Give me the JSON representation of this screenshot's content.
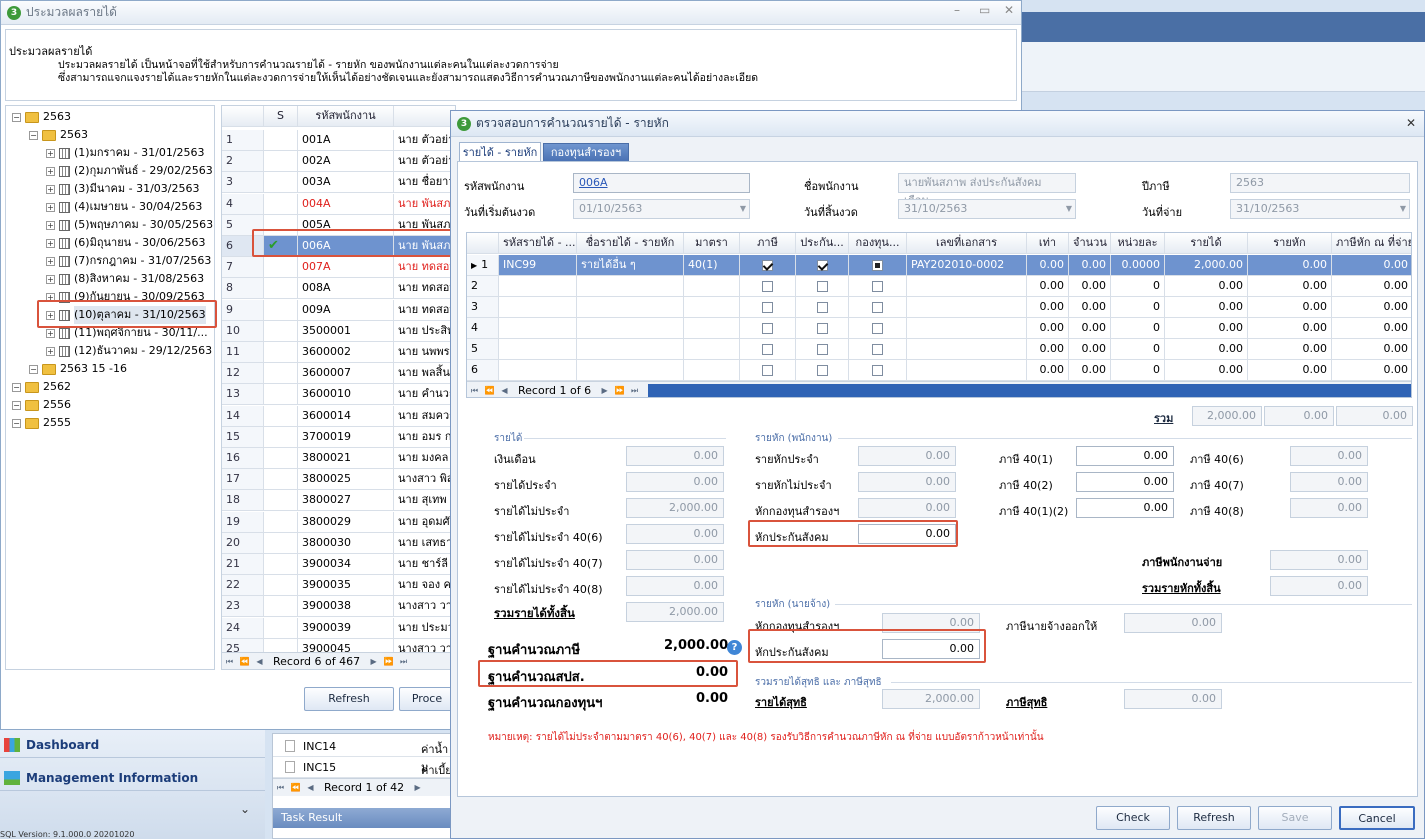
{
  "bg_window": {
    "title": "ประมวลผลรายได้",
    "desc_title": "ประมวลผลรายได้",
    "desc_line1": "ประมวลผลรายได้ เป็นหน้าจอที่ใช้สำหรับการคำนวณรายได้ - รายหัก ของพนักงานแต่ละคนในแต่ละงวดการจ่าย",
    "desc_line2": "ซึ่งสามารถแจกแจงรายได้และรายหักในแต่ละงวดการจ่ายให้เห็นได้อย่างชัดเจนและยังสามารถแสดงวิธีการคำนวณภาษีของพนักงานแต่ละคนได้อย่างละเอียด",
    "tree": [
      {
        "label": "2563",
        "level": 0
      },
      {
        "label": "2563",
        "level": 1
      },
      {
        "label": "(1)มกราคม - 31/01/2563",
        "level": 2
      },
      {
        "label": "(2)กุมภาพันธ์ - 29/02/2563",
        "level": 2
      },
      {
        "label": "(3)มีนาคม - 31/03/2563",
        "level": 2
      },
      {
        "label": "(4)เมษายน - 30/04/2563",
        "level": 2
      },
      {
        "label": "(5)พฤษภาคม - 30/05/2563",
        "level": 2
      },
      {
        "label": "(6)มิถุนายน - 30/06/2563",
        "level": 2
      },
      {
        "label": "(7)กรกฎาคม - 31/07/2563",
        "level": 2
      },
      {
        "label": "(8)สิงหาคม - 31/08/2563",
        "level": 2
      },
      {
        "label": "(9)กันยายน - 30/09/2563",
        "level": 2
      },
      {
        "label": "(10)ตุลาคม - 31/10/2563",
        "level": 2
      },
      {
        "label": "(11)พฤศจิกายน - 30/11/...",
        "level": 2
      },
      {
        "label": "(12)ธันวาคม - 29/12/2563",
        "level": 2
      },
      {
        "label": "2563 15 -16",
        "level": 1
      },
      {
        "label": "2562",
        "level": 0
      },
      {
        "label": "2556",
        "level": 0
      },
      {
        "label": "2555",
        "level": 0
      }
    ],
    "emp_grid": {
      "col_s": "S",
      "col_code": "รหัสพนักงาน",
      "rows": [
        {
          "n": "1",
          "code": "001A",
          "name": "นาย ตัวอย่า",
          "red": false
        },
        {
          "n": "2",
          "code": "002A",
          "name": "นาย ตัวอย่า",
          "red": false
        },
        {
          "n": "3",
          "code": "003A",
          "name": "นาย ชื่อยาว",
          "red": false
        },
        {
          "n": "4",
          "code": "004A",
          "name": "นาย พันสภา",
          "red": true
        },
        {
          "n": "5",
          "code": "005A",
          "name": "นาย พันสภา",
          "red": false
        },
        {
          "n": "6",
          "code": "006A",
          "name": "นาย พันสภา",
          "red": false,
          "selected": true
        },
        {
          "n": "7",
          "code": "007A",
          "name": "นาย ทดสอบ",
          "red": true
        },
        {
          "n": "8",
          "code": "008A",
          "name": "นาย ทดสอบ",
          "red": false
        },
        {
          "n": "9",
          "code": "009A",
          "name": "นาย ทดสอบ",
          "red": false
        },
        {
          "n": "10",
          "code": "3500001",
          "name": "นาย ประสิท",
          "red": false
        },
        {
          "n": "11",
          "code": "3600002",
          "name": "นาย นพพร วิ",
          "red": false
        },
        {
          "n": "12",
          "code": "3600007",
          "name": "นาย พลสิ้นสุ",
          "red": false
        },
        {
          "n": "13",
          "code": "3600010",
          "name": "นาย คำนวณ",
          "red": false
        },
        {
          "n": "14",
          "code": "3600014",
          "name": "นาย สมควร",
          "red": false
        },
        {
          "n": "15",
          "code": "3700019",
          "name": "นาย อมร ก",
          "red": false
        },
        {
          "n": "16",
          "code": "3800021",
          "name": "นาย มงคล ส",
          "red": false
        },
        {
          "n": "17",
          "code": "3800025",
          "name": "นางสาว พิสม",
          "red": false
        },
        {
          "n": "18",
          "code": "3800027",
          "name": "นาย สุเทพ ว",
          "red": false
        },
        {
          "n": "19",
          "code": "3800029",
          "name": "นาย อุดมศัก",
          "red": false
        },
        {
          "n": "20",
          "code": "3800030",
          "name": "นาย เสทธา",
          "red": false
        },
        {
          "n": "21",
          "code": "3900034",
          "name": "นาย ชาร์ลี เ",
          "red": false
        },
        {
          "n": "22",
          "code": "3900035",
          "name": "นาย จอง ครี",
          "red": false
        },
        {
          "n": "23",
          "code": "3900038",
          "name": "นางสาว วารี",
          "red": false
        },
        {
          "n": "24",
          "code": "3900039",
          "name": "นาย ประมวล",
          "red": false
        },
        {
          "n": "25",
          "code": "3900045",
          "name": "นางสาว วาส",
          "red": false
        }
      ],
      "record": "Record 6 of 467"
    },
    "btn_refresh": "Refresh",
    "btn_process": "Proce"
  },
  "left_panel": {
    "dashboard": "Dashboard",
    "management": "Management Information",
    "chevron": "⌄",
    "status": "SQL Version: 9.1.000.0 20201020"
  },
  "task_grid": {
    "rows": [
      {
        "code": "INC14",
        "name": "ค่าน้ำม"
      },
      {
        "code": "INC15",
        "name": "ค่าเบี้ย"
      }
    ],
    "record": "Record 1 of 42",
    "task_result": "Task Result"
  },
  "dialog": {
    "title": "ตรวจสอบการคำนวณรายได้ - รายหัก",
    "close": "✕",
    "tabs": [
      "รายได้ - รายหัก",
      "กองทุนสำรองฯ"
    ],
    "emp_code_label": "รหัสพนักงาน",
    "emp_code": "006A",
    "emp_name_label": "ชื่อพนักงาน",
    "emp_name": "นายพันสภาพ ส่งประกันสังคมเดือน...",
    "tax_year_label": "ปีภาษี",
    "tax_year": "2563",
    "start_label": "วันที่เริ่มต้นงวด",
    "start": "01/10/2563",
    "end_label": "วันที่สิ้นงวด",
    "end": "31/10/2563",
    "pay_label": "วันที่จ่าย",
    "pay": "31/10/2563",
    "grid": {
      "headers": [
        "รหัสรายได้ - ...",
        "ชื่อรายได้ - รายหัก",
        "มาตรา",
        "ภาษี",
        "ประกัน...",
        "กองทุน...",
        "เลขที่เอกสาร",
        "เท่า",
        "จำนวน",
        "หน่วยละ",
        "รายได้",
        "รายหัก",
        "ภาษีหัก ณ ที่จ่าย"
      ],
      "rows": [
        {
          "n": "1",
          "code": "INC99",
          "name": "รายได้อื่น ๆ",
          "sec": "40(1)",
          "tax": "on",
          "ins": "on",
          "fund": "fill",
          "doc": "PAY202010-0002",
          "times": "0.00",
          "qty": "0.00",
          "unit": "0.0000",
          "income": "2,000.00",
          "deduct": "0.00",
          "wht": "0.00"
        },
        {
          "n": "2",
          "code": "",
          "name": "",
          "sec": "",
          "tax": "off",
          "ins": "off",
          "fund": "off",
          "doc": "",
          "times": "0.00",
          "qty": "0.00",
          "unit": "0",
          "income": "0.00",
          "deduct": "0.00",
          "wht": "0.00"
        },
        {
          "n": "3",
          "code": "",
          "name": "",
          "sec": "",
          "tax": "off",
          "ins": "off",
          "fund": "off",
          "doc": "",
          "times": "0.00",
          "qty": "0.00",
          "unit": "0",
          "income": "0.00",
          "deduct": "0.00",
          "wht": "0.00"
        },
        {
          "n": "4",
          "code": "",
          "name": "",
          "sec": "",
          "tax": "off",
          "ins": "off",
          "fund": "off",
          "doc": "",
          "times": "0.00",
          "qty": "0.00",
          "unit": "0",
          "income": "0.00",
          "deduct": "0.00",
          "wht": "0.00"
        },
        {
          "n": "5",
          "code": "",
          "name": "",
          "sec": "",
          "tax": "off",
          "ins": "off",
          "fund": "off",
          "doc": "",
          "times": "0.00",
          "qty": "0.00",
          "unit": "0",
          "income": "0.00",
          "deduct": "0.00",
          "wht": "0.00"
        },
        {
          "n": "6",
          "code": "",
          "name": "",
          "sec": "",
          "tax": "off",
          "ins": "off",
          "fund": "off",
          "doc": "",
          "times": "0.00",
          "qty": "0.00",
          "unit": "0",
          "income": "0.00",
          "deduct": "0.00",
          "wht": "0.00"
        }
      ],
      "record": "Record 1 of 6"
    },
    "total_label": "รวม",
    "totals": [
      "2,000.00",
      "0.00",
      "0.00"
    ],
    "income_section": "รายได้",
    "income_fields": [
      {
        "label": "เงินเดือน",
        "value": "0.00"
      },
      {
        "label": "รายได้ประจำ",
        "value": "0.00"
      },
      {
        "label": "รายได้ไม่ประจำ",
        "value": "2,000.00"
      },
      {
        "label": "รายได้ไม่ประจำ 40(6)",
        "value": "0.00"
      },
      {
        "label": "รายได้ไม่ประจำ 40(7)",
        "value": "0.00"
      },
      {
        "label": "รายได้ไม่ประจำ 40(8)",
        "value": "0.00"
      }
    ],
    "income_total_label": "รวมรายได้ทั้งสิ้น",
    "income_total": "2,000.00",
    "ded_emp_section": "รายหัก (พนักงาน)",
    "ded_emp_fields": [
      {
        "label": "รายหักประจำ",
        "value": "0.00"
      },
      {
        "label": "รายหักไม่ประจำ",
        "value": "0.00"
      },
      {
        "label": "หักกองทุนสำรองฯ",
        "value": "0.00"
      },
      {
        "label": "หักประกันสังคม",
        "value": "0.00"
      }
    ],
    "tax_fields_a": [
      {
        "label": "ภาษี 40(1)",
        "value": "0.00"
      },
      {
        "label": "ภาษี 40(2)",
        "value": "0.00"
      },
      {
        "label": "ภาษี 40(1)(2)",
        "value": "0.00"
      }
    ],
    "tax_fields_b": [
      {
        "label": "ภาษี 40(6)",
        "value": "0.00"
      },
      {
        "label": "ภาษี 40(7)",
        "value": "0.00"
      },
      {
        "label": "ภาษี 40(8)",
        "value": "0.00"
      }
    ],
    "emp_tax_label": "ภาษีพนักงานจ่าย",
    "emp_tax": "0.00",
    "ded_total_label": "รวมรายหักทั้งสิ้น",
    "ded_total": "0.00",
    "ded_er_section": "รายหัก (นายจ้าง)",
    "er_fund_label": "หักกองทุนสำรองฯ",
    "er_fund": "0.00",
    "er_sso_label": "หักประกันสังคม",
    "er_sso": "0.00",
    "er_tax_label": "ภาษีนายจ้างออกให้",
    "er_tax": "0.00",
    "net_section": "รวมรายได้สุทธิ และ ภาษีสุทธิ",
    "net_income_label": "รายได้สุทธิ",
    "net_income": "2,000.00",
    "net_tax_label": "ภาษีสุทธิ",
    "net_tax": "0.00",
    "base_tax_label": "ฐานคำนวณภาษี",
    "base_tax": "2,000.00",
    "base_sso_label": "ฐานคำนวณสปส.",
    "base_sso": "0.00",
    "base_fund_label": "ฐานคำนวณกองทุนฯ",
    "base_fund": "0.00",
    "note": "หมายเหตุ: รายได้ไม่ประจำตามมาตรา 40(6), 40(7) และ 40(8)  รองรับวิธีการคำนวณภาษีหัก ณ ที่จ่าย แบบอัตราก้าวหน้าเท่านั้น",
    "btn_check": "Check",
    "btn_refresh": "Refresh",
    "btn_save": "Save",
    "btn_cancel": "Cancel"
  },
  "colors": {
    "accent": "#3c6fb6",
    "highlight": "#d9533c",
    "selected_row": "#6e93cf",
    "red_text": "#e0201c",
    "note": "#e0201c"
  }
}
